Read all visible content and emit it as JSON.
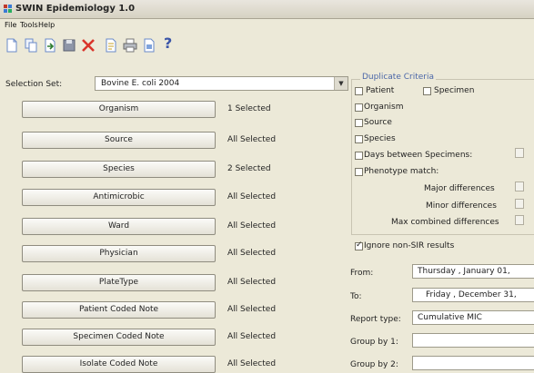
{
  "window": {
    "title": "SWIN Epidemiology 1.0"
  },
  "menu": {
    "items": [
      "File",
      "Tools",
      "Help"
    ]
  },
  "toolbar": {
    "buttons": [
      {
        "icon": "new-document-icon"
      },
      {
        "icon": "copy-icon"
      },
      {
        "icon": "import-icon"
      },
      {
        "icon": "save-icon"
      },
      {
        "icon": "delete-icon"
      },
      {
        "icon": "report-icon"
      },
      {
        "icon": "print-icon"
      },
      {
        "icon": "export-icon"
      },
      {
        "icon": "help-icon"
      }
    ],
    "help_glyph": "?"
  },
  "selection": {
    "label": "Selection Set:",
    "value": "Bovine E. coli 2004"
  },
  "criteria": [
    {
      "label": "Organism",
      "status": "1 Selected"
    },
    {
      "label": "Source",
      "status": "All Selected"
    },
    {
      "label": "Species",
      "status": "2 Selected"
    },
    {
      "label": "Antimicrobic",
      "status": "All Selected"
    },
    {
      "label": "Ward",
      "status": "All Selected"
    },
    {
      "label": "Physician",
      "status": "All Selected"
    },
    {
      "label": "PlateType",
      "status": "All Selected"
    },
    {
      "label": "Patient Coded Note",
      "status": "All Selected"
    },
    {
      "label": "Specimen Coded Note",
      "status": "All Selected"
    },
    {
      "label": "Isolate Coded Note",
      "status": "All Selected"
    }
  ],
  "duplicate": {
    "title": "Duplicate Criteria",
    "patient": {
      "label": "Patient",
      "checked": false
    },
    "specimen": {
      "label": "Specimen",
      "checked": false
    },
    "organism": {
      "label": "Organism",
      "checked": false
    },
    "source": {
      "label": "Source",
      "checked": false
    },
    "species": {
      "label": "Species",
      "checked": false
    },
    "days_between": {
      "label": "Days between Specimens:",
      "checked": false
    },
    "phenotype": {
      "label": "Phenotype match:",
      "checked": false
    },
    "major": {
      "label": "Major differences"
    },
    "minor": {
      "label": "Minor differences"
    },
    "max_combined": {
      "label": "Max combined differences"
    },
    "ignore_non_sir": {
      "label": "Ignore non-SIR results",
      "checked": true
    }
  },
  "report": {
    "from_label": "From:",
    "from_value": "Thursday ,  January   01,",
    "to_label": "To:",
    "to_value": "Friday    , December  31,",
    "type_label": "Report type:",
    "type_value": "Cumulative MIC",
    "group1_label": "Group by 1:",
    "group1_value": "",
    "group2_label": "Group by 2:",
    "group2_value": ""
  },
  "colors": {
    "group_title": "#4b67a8",
    "delete_icon": "#d9342b",
    "help_icon": "#3a55a8"
  }
}
